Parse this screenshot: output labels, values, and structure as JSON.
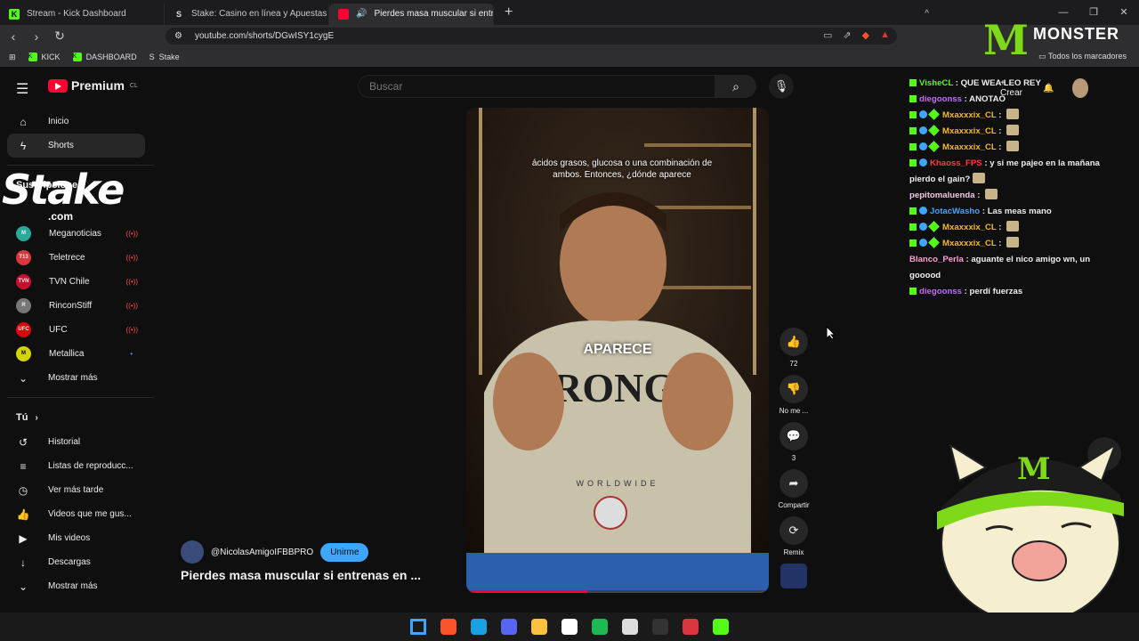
{
  "browser": {
    "tabs": [
      {
        "label": "Stream - Kick Dashboard",
        "icon": "K"
      },
      {
        "label": "Stake: Casino en línea y Apuestas De",
        "icon": "S"
      },
      {
        "label": "Pierdes masa muscular si entr",
        "icon": ""
      }
    ],
    "new_tab": "+",
    "window_controls": [
      "—",
      "❐",
      "✕"
    ],
    "url": "youtube.com/shorts/DGwISY1cygE",
    "bookmarks": [
      {
        "label": "KICK",
        "icon": "K"
      },
      {
        "label": "DASHBOARD",
        "icon": "K"
      },
      {
        "label": "Stake",
        "icon": "S"
      }
    ],
    "all_bookmarks": "Todos los marcadores"
  },
  "youtube": {
    "logo": "Premium",
    "logo_region": "CL",
    "search_placeholder": "Buscar",
    "create_label": "Crear",
    "sidebar_top": [
      {
        "label": "Inicio",
        "icon": "⌂"
      },
      {
        "label": "Shorts",
        "icon": "ϟ"
      }
    ],
    "subscriptions_title": "Suscripciones",
    "subscriptions": [
      {
        "label": "Meganoticias",
        "icon": "M",
        "color": "#2aa99b",
        "badge": "((•))"
      },
      {
        "label": "Teletrece",
        "icon": "T13",
        "color": "#d9363e",
        "badge": "((•))"
      },
      {
        "label": "TVN Chile",
        "icon": "TVN",
        "color": "#c8102e",
        "badge": "((•))"
      },
      {
        "label": "RinconStiff",
        "icon": "R",
        "color": "#777777",
        "badge": "((•))"
      },
      {
        "label": "UFC",
        "icon": "UFC",
        "color": "#d20a0a",
        "badge": "((•))"
      },
      {
        "label": "Metallica",
        "icon": "M",
        "color": "#d4d400",
        "badge": "•"
      }
    ],
    "show_more": "Mostrar más",
    "you_title": "Tú",
    "you_items": [
      {
        "label": "Historial",
        "icon": "↺"
      },
      {
        "label": "Listas de reproducc...",
        "icon": "≡"
      },
      {
        "label": "Ver más tarde",
        "icon": "◷"
      },
      {
        "label": "Videos que me gus...",
        "icon": "👍"
      },
      {
        "label": "Mis videos",
        "icon": "▶"
      },
      {
        "label": "Descargas",
        "icon": "↓"
      }
    ],
    "show_more_2": "Mostrar más",
    "video": {
      "caption": "ácidos grasos, glucosa o una combinación de ambos. Entonces, ¿dónde aparece",
      "big_word": "APARECE",
      "progress": 0.4
    },
    "actions": {
      "likes": "72",
      "dislike_label": "No me ...",
      "comments": "3",
      "share_label": "Compartir",
      "remix_label": "Remix"
    },
    "channel": "@NicolasAmigoIFBBPRO",
    "join_label": "Unirme",
    "title": "Pierdes masa muscular si entrenas en ..."
  },
  "overlay": {
    "stake_logo": "Stake",
    "stake_domain": ".com",
    "monster_word": "MONSTER",
    "chat": [
      {
        "user": "VisheCL",
        "text": "QUE WEA LEO REY",
        "color": "#53fc18",
        "badges": 1,
        "emote": false
      },
      {
        "user": "diegoonss",
        "text": "ANOTAO",
        "color": "#c36bff",
        "badges": 1,
        "emote": false
      },
      {
        "user": "Mxaxxxix_CL",
        "text": "",
        "color": "#f5b833",
        "badges": 3,
        "emote": true
      },
      {
        "user": "Mxaxxxix_CL",
        "text": "",
        "color": "#f5b833",
        "badges": 3,
        "emote": true
      },
      {
        "user": "Mxaxxxix_CL",
        "text": "",
        "color": "#f5b833",
        "badges": 3,
        "emote": true
      },
      {
        "user": "Khaoss_FPS",
        "text": "y si me pajeo en la mañana pierdo el gain?",
        "color": "#ff3b3b",
        "badges": 2,
        "emote": true
      },
      {
        "user": "pepitomaluenda",
        "text": "",
        "color": "#f3c7e8",
        "badges": 0,
        "emote": true
      },
      {
        "user": "JotacWasho",
        "text": "Las meas mano",
        "color": "#3ea6ff",
        "badges": 2,
        "emote": false
      },
      {
        "user": "Mxaxxxix_CL",
        "text": "",
        "color": "#f5b833",
        "badges": 3,
        "emote": true
      },
      {
        "user": "Mxaxxxix_CL",
        "text": "",
        "color": "#f5b833",
        "badges": 3,
        "emote": true
      },
      {
        "user": "Blanco_Perla",
        "text": "aguante el nico amigo wn, un gooood",
        "color": "#ff9ed2",
        "badges": 0,
        "emote": false
      },
      {
        "user": "diegoonss",
        "text": "perdí fuerzas",
        "color": "#c36bff",
        "badges": 1,
        "emote": false
      }
    ]
  },
  "taskbar": {
    "apps": [
      {
        "name": "windows-start",
        "color": "#3ea6ff"
      },
      {
        "name": "brave",
        "color": "#fb542b"
      },
      {
        "name": "edge",
        "color": "#1ba1e2"
      },
      {
        "name": "discord",
        "color": "#5865f2"
      },
      {
        "name": "file-explorer",
        "color": "#f9c13c"
      },
      {
        "name": "media",
        "color": "#ffffff"
      },
      {
        "name": "spotify",
        "color": "#1db954"
      },
      {
        "name": "obs",
        "color": "#dddddd"
      },
      {
        "name": "app",
        "color": "#333333"
      },
      {
        "name": "app-red",
        "color": "#d9363e"
      },
      {
        "name": "kick",
        "color": "#53fc18"
      }
    ],
    "tray": "^"
  }
}
